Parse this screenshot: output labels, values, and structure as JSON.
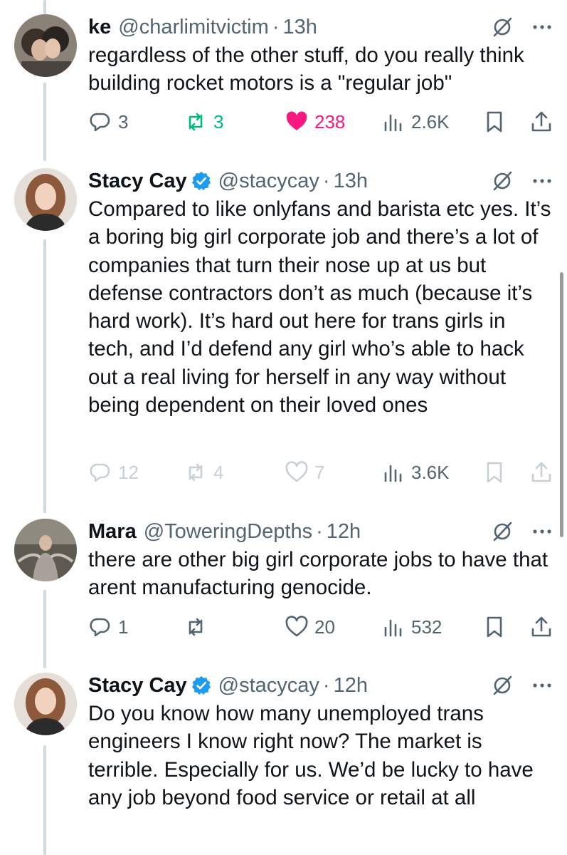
{
  "colors": {
    "accent_blue": "#1d9bf0",
    "like_pink": "#f91880",
    "repost_green": "#00ba7c",
    "secondary_text": "#536471",
    "thread_line": "#cfd9de"
  },
  "tweets": [
    {
      "name": "ke",
      "verified": false,
      "handle": "@charlimitvictim",
      "separator": "·",
      "time": "13h",
      "text": "regardless of the other stuff, do you really think building rocket motors is a \"regular job\"",
      "replies": "3",
      "reposts": "3",
      "likes": "238",
      "views": "2.6K",
      "liked": true,
      "reposted": true
    },
    {
      "name": "Stacy Cay",
      "verified": true,
      "handle": "@stacycay",
      "separator": "·",
      "time": "13h",
      "text": "Compared to like onlyfans and barista etc yes. It’s a boring big girl corporate job and there’s a lot of companies that turn their nose up at us but defense contractors don’t as much (because it’s hard work). It’s hard out here for trans girls in tech, and I’d defend any girl who’s able to hack out a real living for herself in any way without being dependent on their loved ones",
      "replies": "12",
      "reposts": "4",
      "likes": "7",
      "views": "3.6K",
      "liked": false,
      "reposted": false
    },
    {
      "name": "Mara",
      "verified": false,
      "handle": "@ToweringDepths",
      "separator": "·",
      "time": "12h",
      "text": "there are other big girl corporate jobs to have that arent manufacturing genocide.",
      "replies": "1",
      "reposts": "",
      "likes": "20",
      "views": "532",
      "liked": false,
      "reposted": false
    },
    {
      "name": "Stacy Cay",
      "verified": true,
      "handle": "@stacycay",
      "separator": "·",
      "time": "12h",
      "text": "Do you know how many unemployed trans engineers I know right now? The market is terrible. Especially for us. We’d be lucky to have any job beyond food service or retail at all"
    }
  ]
}
